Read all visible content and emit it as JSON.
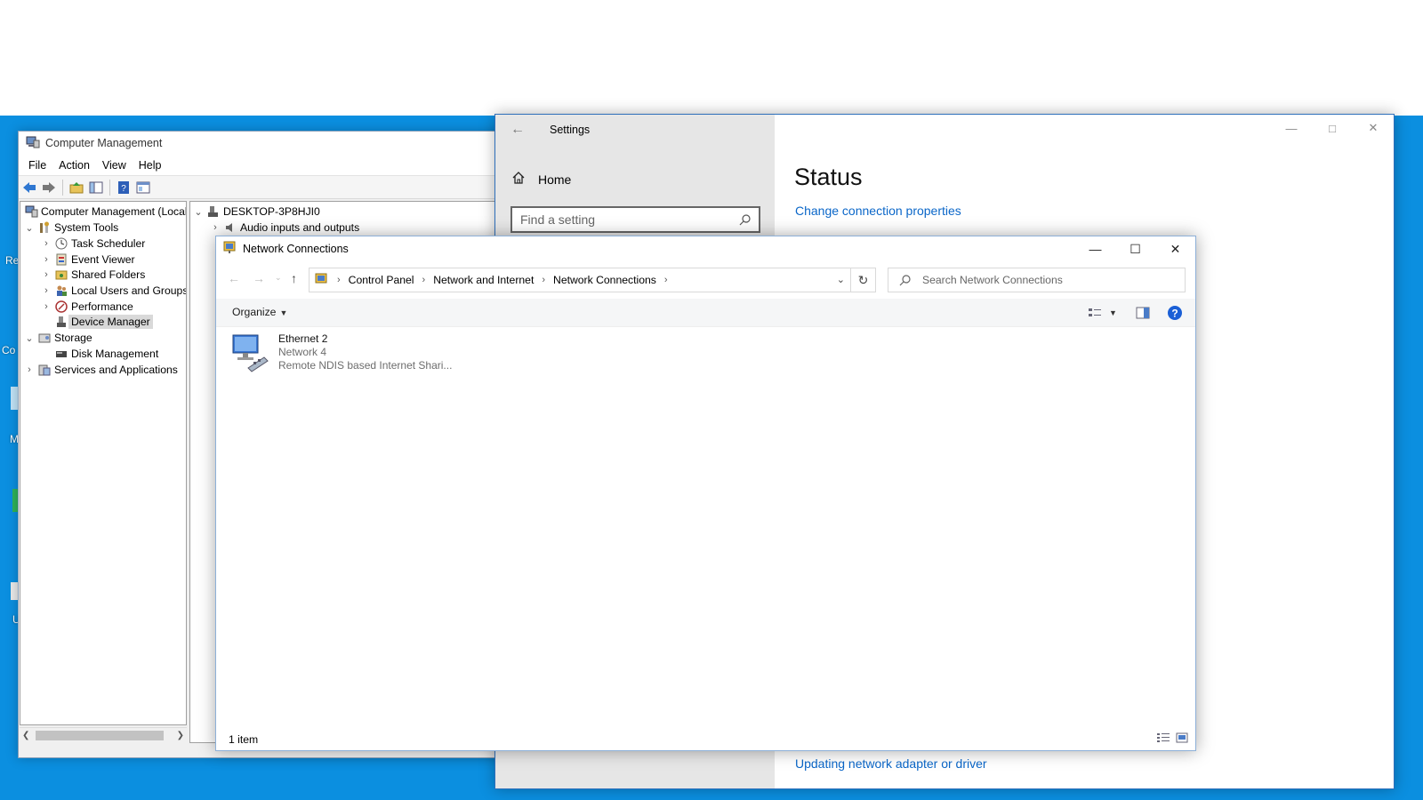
{
  "desktop": {
    "fragments": [
      "Re",
      "Co",
      "M",
      "U"
    ]
  },
  "computer_management": {
    "title": "Computer Management",
    "menu": [
      "File",
      "Action",
      "View",
      "Help"
    ],
    "tree": {
      "root": "Computer Management (Local",
      "system_tools": "System Tools",
      "task_scheduler": "Task Scheduler",
      "event_viewer": "Event Viewer",
      "shared_folders": "Shared Folders",
      "local_users": "Local Users and Groups",
      "performance": "Performance",
      "device_manager": "Device Manager",
      "storage": "Storage",
      "disk_management": "Disk Management",
      "services": "Services and Applications"
    },
    "devices": {
      "computer": "DESKTOP-3P8HJI0",
      "audio": "Audio inputs and outputs"
    }
  },
  "settings": {
    "title": "Settings",
    "home": "Home",
    "search_placeholder": "Find a setting",
    "page_title": "Status",
    "link_change": "Change connection properties",
    "link_update": "Updating network adapter or driver"
  },
  "network_connections": {
    "title": "Network Connections",
    "breadcrumb": [
      "Control Panel",
      "Network and Internet",
      "Network Connections"
    ],
    "search_placeholder": "Search Network Connections",
    "organize": "Organize",
    "item": {
      "name": "Ethernet 2",
      "network": "Network 4",
      "device": "Remote NDIS based Internet Shari..."
    },
    "status": "1 item"
  },
  "colors": {
    "desktop": "#0b8fe0",
    "link": "#0a66c8",
    "help_icon": "#1a5fd6"
  }
}
